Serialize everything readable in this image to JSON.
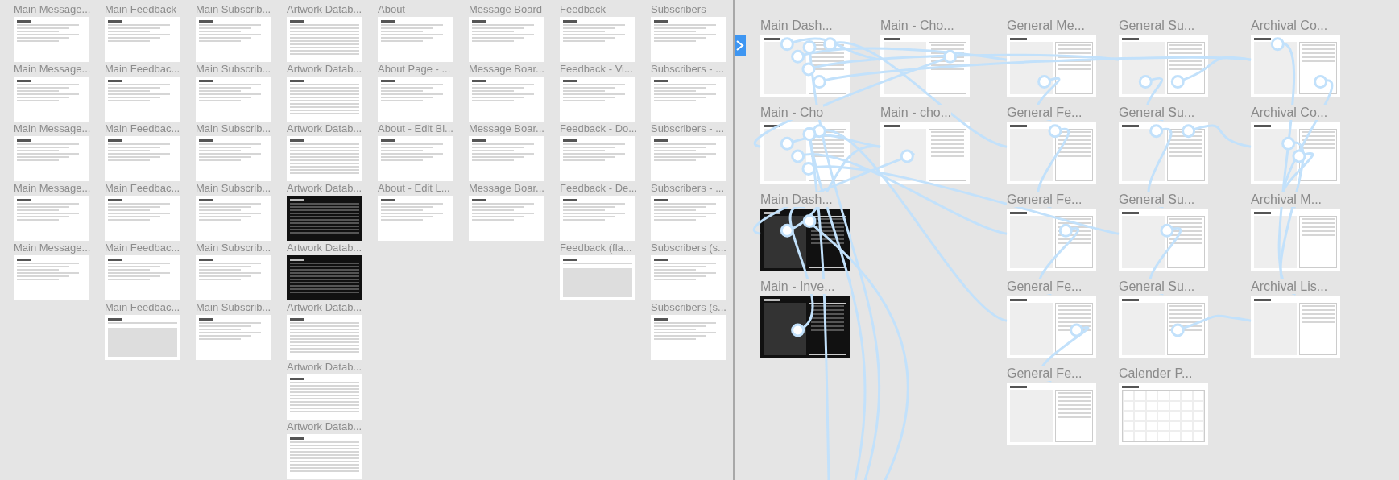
{
  "page_canvas": {
    "columns": [
      {
        "frames": [
          {
            "label": "Main Message...",
            "kind": "list"
          },
          {
            "label": "Main Message...",
            "kind": "list"
          },
          {
            "label": "Main Message...",
            "kind": "list"
          },
          {
            "label": "Main Message...",
            "kind": "list"
          },
          {
            "label": "Main Message...",
            "kind": "list"
          }
        ]
      },
      {
        "frames": [
          {
            "label": "Main Feedback",
            "kind": "list"
          },
          {
            "label": "Main Feedbac...",
            "kind": "list"
          },
          {
            "label": "Main Feedbac...",
            "kind": "list"
          },
          {
            "label": "Main Feedbac...",
            "kind": "list"
          },
          {
            "label": "Main Feedbac...",
            "kind": "list"
          },
          {
            "label": "Main Feedbac...",
            "kind": "block"
          }
        ]
      },
      {
        "frames": [
          {
            "label": "Main Subscrib...",
            "kind": "list"
          },
          {
            "label": "Main Subscrib...",
            "kind": "list"
          },
          {
            "label": "Main Subscrib...",
            "kind": "list"
          },
          {
            "label": "Main Subscrib...",
            "kind": "list"
          },
          {
            "label": "Main Subscrib...",
            "kind": "list"
          },
          {
            "label": "Main Subscrib...",
            "kind": "list"
          }
        ]
      },
      {
        "frames": [
          {
            "label": "Artwork Datab...",
            "kind": "table"
          },
          {
            "label": "Artwork Datab...",
            "kind": "table"
          },
          {
            "label": "Artwork Datab...",
            "kind": "table"
          },
          {
            "label": "Artwork Datab...",
            "kind": "dark-table"
          },
          {
            "label": "Artwork Datab...",
            "kind": "dark-table"
          },
          {
            "label": "Artwork Datab...",
            "kind": "table"
          },
          {
            "label": "Artwork Datab...",
            "kind": "table"
          },
          {
            "label": "Artwork Datab...",
            "kind": "table"
          }
        ]
      },
      {
        "frames": [
          {
            "label": "About",
            "kind": "list"
          },
          {
            "label": "About Page - ...",
            "kind": "list"
          },
          {
            "label": "About - Edit Bl...",
            "kind": "list"
          },
          {
            "label": "About - Edit L...",
            "kind": "list"
          }
        ]
      },
      {
        "frames": [
          {
            "label": "Message Board",
            "kind": "list"
          },
          {
            "label": "Message Boar...",
            "kind": "list"
          },
          {
            "label": "Message Boar...",
            "kind": "list"
          },
          {
            "label": "Message Boar...",
            "kind": "list"
          }
        ]
      },
      {
        "frames": [
          {
            "label": "Feedback",
            "kind": "list"
          },
          {
            "label": "Feedback - Vi...",
            "kind": "list"
          },
          {
            "label": "Feedback - Do...",
            "kind": "list"
          },
          {
            "label": "Feedback - De...",
            "kind": "list"
          },
          {
            "label": "Feedback (fla...",
            "kind": "block"
          }
        ]
      },
      {
        "frames": [
          {
            "label": "Subscribers",
            "kind": "list"
          },
          {
            "label": "Subscribers - ...",
            "kind": "list"
          },
          {
            "label": "Subscribers - ...",
            "kind": "list"
          },
          {
            "label": "Subscribers - ...",
            "kind": "list"
          },
          {
            "label": "Subscribers (s...",
            "kind": "list"
          },
          {
            "label": "Subscribers (s...",
            "kind": "list"
          }
        ]
      }
    ]
  },
  "prototype_canvas": {
    "columns": [
      {
        "frames": [
          {
            "label": "Main Dash...",
            "kind": "dashboard"
          },
          {
            "label": "Main - Cho",
            "kind": "dashboard"
          },
          {
            "label": "Main Dash...",
            "kind": "dark-dashboard"
          },
          {
            "label": "Main - Inve...",
            "kind": "dark-dashboard"
          }
        ]
      },
      {
        "frames": [
          {
            "label": "Main - Cho...",
            "kind": "dashboard"
          },
          {
            "label": "Main - cho...",
            "kind": "dashboard"
          }
        ]
      },
      {
        "frames": [
          {
            "label": "General Me...",
            "kind": "dashboard"
          },
          {
            "label": "General Fe...",
            "kind": "dashboard"
          },
          {
            "label": "General Fe...",
            "kind": "dashboard"
          },
          {
            "label": "General Fe...",
            "kind": "dashboard"
          },
          {
            "label": "General Fe...",
            "kind": "dashboard"
          }
        ]
      },
      {
        "frames": [
          {
            "label": "General Su...",
            "kind": "dashboard"
          },
          {
            "label": "General Su...",
            "kind": "dashboard"
          },
          {
            "label": "General Su...",
            "kind": "dashboard"
          },
          {
            "label": "General Su...",
            "kind": "dashboard"
          },
          {
            "label": "Calender P...",
            "kind": "calendar"
          }
        ]
      },
      {
        "frames": [
          {
            "label": "Archival Co...",
            "kind": "archive"
          },
          {
            "label": "Archival Co...",
            "kind": "archive"
          },
          {
            "label": "Archival M...",
            "kind": "archive"
          },
          {
            "label": "Archival Lis...",
            "kind": "archive"
          }
        ]
      }
    ]
  }
}
